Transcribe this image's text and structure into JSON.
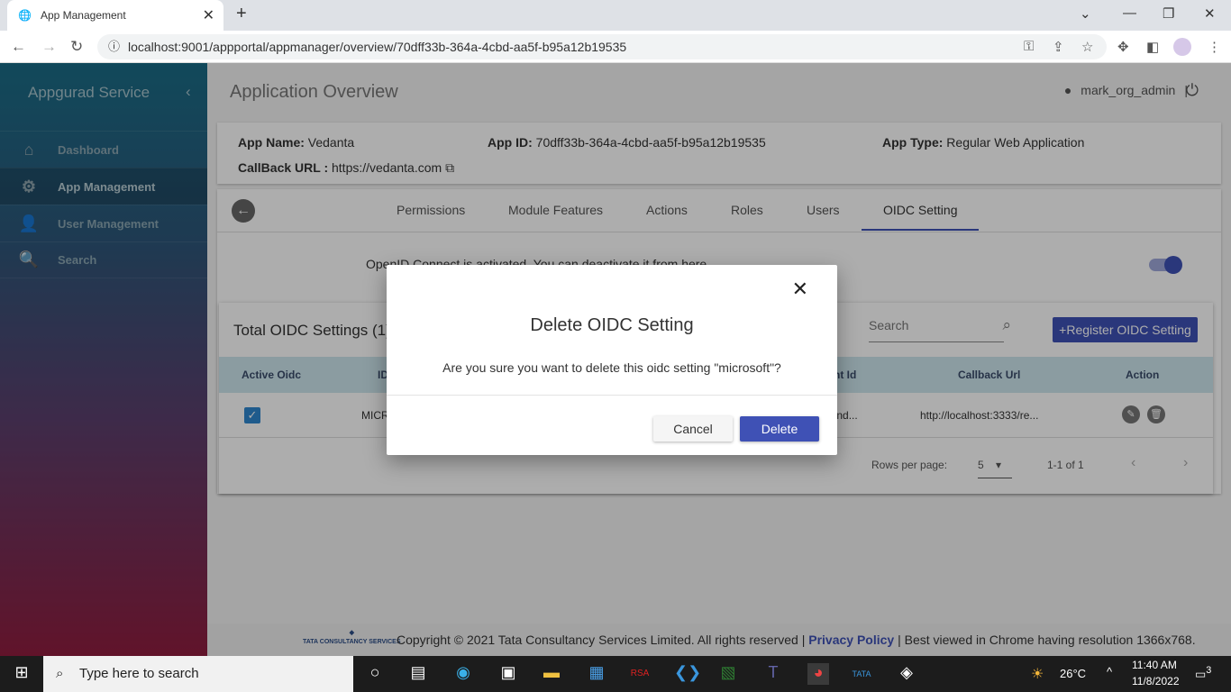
{
  "browser": {
    "tab_title": "App Management",
    "url": "localhost:9001/appportal/appmanager/overview/70dff33b-364a-4cbd-aa5f-b95a12b19535"
  },
  "sidebar": {
    "title": "Appgurad Service",
    "items": [
      {
        "label": "Dashboard",
        "icon": "home-icon"
      },
      {
        "label": "App Management",
        "icon": "app-gear-icon"
      },
      {
        "label": "User Management",
        "icon": "user-gear-icon"
      },
      {
        "label": "Search",
        "icon": "search-icon"
      }
    ]
  },
  "header": {
    "title": "Application Overview",
    "user": "mark_org_admin",
    "separator": "|"
  },
  "app_info": {
    "name_label": "App Name:",
    "name": "Vedanta",
    "id_label": "App ID:",
    "id": "70dff33b-364a-4cbd-aa5f-b95a12b19535",
    "type_label": "App Type:",
    "type": "Regular Web Application",
    "callback_label": "CallBack URL :",
    "callback": "https://vedanta.com"
  },
  "tabs": [
    "Permissions",
    "Module Features",
    "Actions",
    "Roles",
    "Users",
    "OIDC Setting"
  ],
  "oidc": {
    "message": "OpenID Connect is activated. You can deactivate it from here.",
    "active": true,
    "total": "Total OIDC Settings (1)",
    "search_placeholder": "Search",
    "register_label": "Register OIDC Setting",
    "columns": [
      "Active Oidc",
      "ID",
      "Client Id",
      "Callback Url",
      "Action"
    ],
    "rows": [
      {
        "active": true,
        "id": "MICROSOFT",
        "client_id": "2jknd...",
        "callback": "http://localhost:3333/re..."
      }
    ],
    "rows_per_page_label": "Rows per page:",
    "rows_per_page": "5",
    "range": "1-1 of 1"
  },
  "footer": {
    "logo": "TATA CONSULTANCY SERVICES",
    "text_before": "Copyright © 2021 Tata Consultancy Services Limited. All rights reserved |",
    "link": "Privacy Policy",
    "text_after": "| Best viewed in Chrome having resolution 1366x768."
  },
  "dialog": {
    "title": "Delete OIDC Setting",
    "message": "Are you sure you want to delete this oidc setting \"microsoft\"?",
    "cancel": "Cancel",
    "delete": "Delete"
  },
  "taskbar": {
    "search": "Type here to search",
    "weather": "26°C",
    "time": "11:40 AM",
    "date": "11/8/2022",
    "notifications": "3"
  },
  "colors": {
    "primary": "#3f51b5",
    "table_header": "#cde6ee"
  }
}
